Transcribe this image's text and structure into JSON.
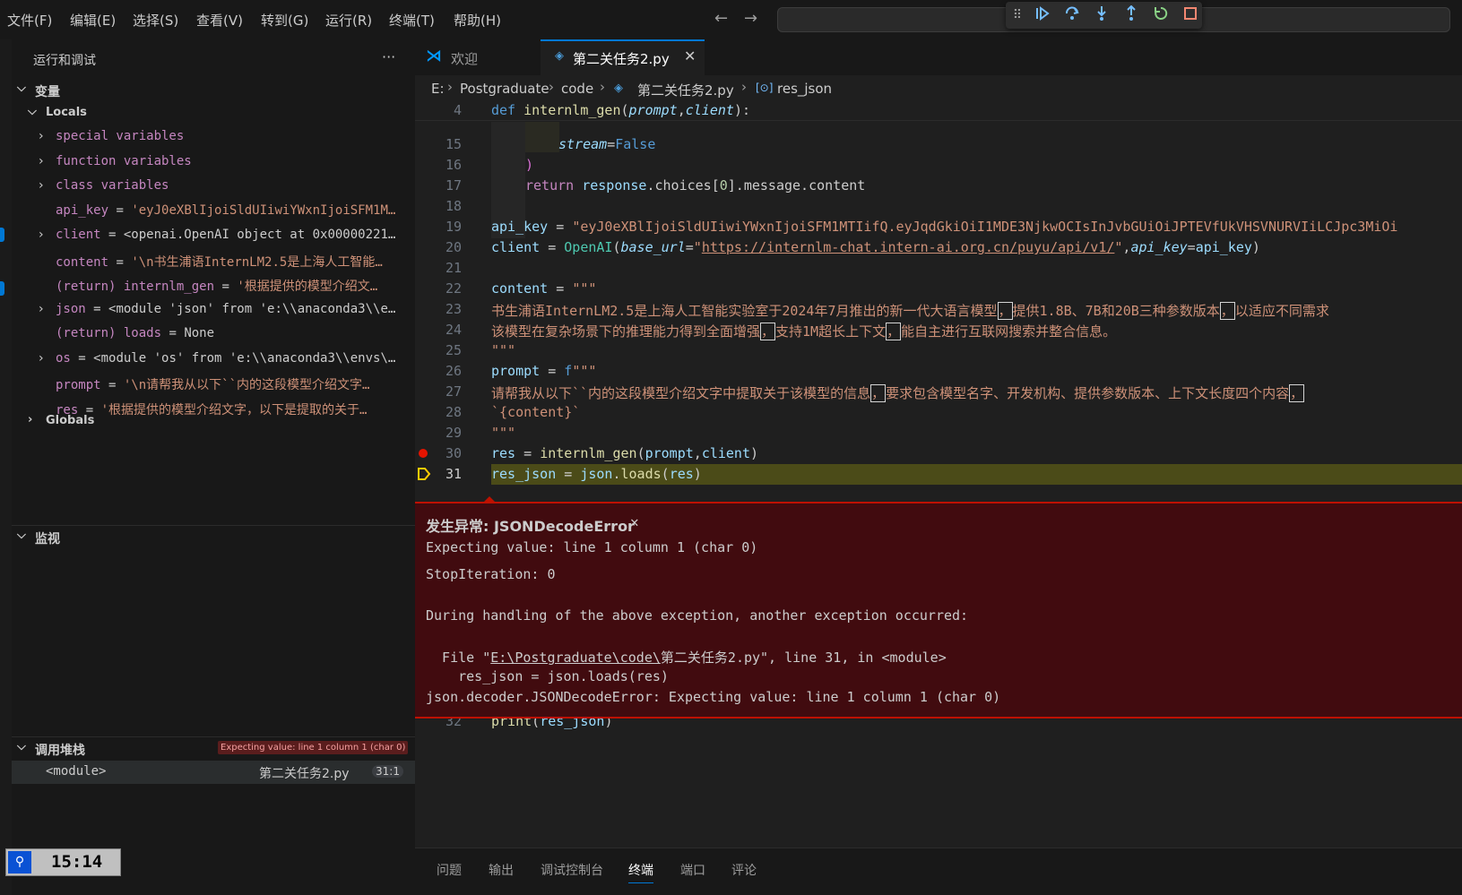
{
  "menu": [
    "文件(F)",
    "编辑(E)",
    "选择(S)",
    "查看(V)",
    "转到(G)",
    "运行(R)",
    "终端(T)",
    "帮助(H)"
  ],
  "sidebar": {
    "title": "运行和调试",
    "more": "···",
    "variables_label": "变量",
    "locals_label": "Locals",
    "globals_label": "Globals",
    "vars": [
      {
        "text": "special variables"
      },
      {
        "text": "function variables"
      },
      {
        "text": "class variables"
      },
      {
        "name": "api_key",
        "value": "'eyJ0eXBlIjoiSldUIiwiYWxnIjoiSFM1M…"
      },
      {
        "name": "client",
        "value": "<openai.OpenAI object at 0x00000221…"
      },
      {
        "name": "content",
        "value": "'\\n书生浦语InternLM2.5是上海人工智能…"
      },
      {
        "name": "(return) internlm_gen",
        "value": "'根据提供的模型介绍文…"
      },
      {
        "name": "json",
        "value": "<module 'json' from 'e:\\\\anaconda3\\\\e…"
      },
      {
        "name": "(return) loads",
        "value": "None"
      },
      {
        "name": "os",
        "value": "<module 'os' from 'e:\\\\anaconda3\\\\envs\\…"
      },
      {
        "name": "prompt",
        "value": "'\\n请帮我从以下``内的这段模型介绍文字…"
      },
      {
        "name": "res",
        "value": "'根据提供的模型介绍文字，以下是提取的关于…"
      }
    ],
    "watch_label": "监视",
    "callstack_label": "调用堆栈",
    "callstack_badge": "Expecting value: line 1 column 1 (char 0)",
    "frame_name": "<module>",
    "frame_file": "第二关任务2.py",
    "frame_pos": "31:1"
  },
  "tabs": [
    {
      "label": "欢迎",
      "active": false
    },
    {
      "label": "第二关任务2.py",
      "active": true
    }
  ],
  "breadcrumb": [
    "E:",
    "Postgraduate",
    "code",
    "第二关任务2.py",
    "res_json"
  ],
  "code": {
    "l4": "4",
    "l15": "15",
    "l16": "16",
    "l17": "17",
    "l18": "18",
    "l19": "19",
    "l20": "20",
    "l21": "21",
    "l22": "22",
    "l23": "23",
    "l24": "24",
    "l25": "25",
    "l26": "26",
    "l27": "27",
    "l28": "28",
    "l29": "29",
    "l30": "30",
    "l31": "31",
    "l32": "32",
    "api_key_str": "\"eyJ0eXBlIjoiSldUIiwiYWxnIjoiSFM1MTIifQ.eyJqdGkiOiI1MDE3NjkwOCIsInJvbGUiOiJPTEVfUkVHSVNURVIiLCJpc3MiOi",
    "url": "https://internlm-chat.intern-ai.org.cn/puyu/api/v1/",
    "content_line1": "书生浦语InternLM2.5是上海人工智能实验室于2024年7月推出的新一代大语言模型",
    "content_line1b": "提供1.8B、7B和20B三种参数版本",
    "content_line1c": "以适应不同需求",
    "content_line2a": "该模型在复杂场景下的推理能力得到全面增强",
    "content_line2b": "支持1M超长上下文",
    "content_line2c": "能自主进行互联网搜索并整合信息。",
    "prompt_line1a": "请帮我从以下``内的这段模型介绍文字中提取关于该模型的信息",
    "prompt_line1b": "要求包含模型名字、开发机构、提供参数版本、上下文长度四个内容",
    "prompt_line2": "`{content}`"
  },
  "exception": {
    "title": "发生异常: JSONDecodeError",
    "l1": "Expecting value: line 1 column 1 (char 0)",
    "l2": "StopIteration: 0",
    "l3": "During handling of the above exception, another exception occurred:",
    "l4a": "  File \"",
    "l4link": "E:\\Postgraduate\\code\\",
    "l4b": "第二关任务2.py\", line 31, in <module>",
    "l5": "    res_json = json.loads(res)",
    "l6": "json.decoder.JSONDecodeError: Expecting value: line 1 column 1 (char 0)"
  },
  "panel_tabs": [
    "问题",
    "输出",
    "调试控制台",
    "终端",
    "端口",
    "评论"
  ],
  "panel_active": "终端",
  "clock": "15:14",
  "colors": {
    "accent": "#0078d4",
    "error": "#be1100",
    "current_line": "#4b4b18"
  }
}
